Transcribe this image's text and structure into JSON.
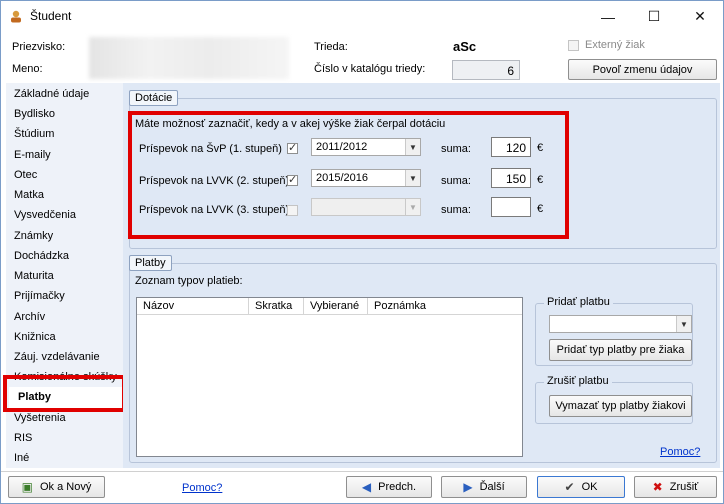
{
  "window": {
    "title": "Študent"
  },
  "header": {
    "surname_label": "Priezvisko:",
    "firstname_label": "Meno:",
    "class_label": "Trieda:",
    "class_value": "aSc",
    "catalog_label": "Číslo v katalógu triedy:",
    "catalog_value": "6",
    "external_label": "Externý žiak",
    "allow_change_button": "Povoľ zmenu údajov"
  },
  "sidebar": {
    "items": [
      "Základné údaje",
      "Bydlisko",
      "Štúdium",
      "E-maily",
      "Otec",
      "Matka",
      "Vysvedčenia",
      "Známky",
      "Dochádzka",
      "Maturita",
      "Prijímačky",
      "Archív",
      "Knižnica",
      "Záuj. vzdelávanie",
      "Komisionálne skúšky",
      "Platby",
      "Vyšetrenia",
      "RIS",
      "Iné"
    ],
    "selected": "Platby"
  },
  "dotacie": {
    "legend": "Dotácie",
    "intro": "Máte možnosť zaznačiť, kedy a v akej výške žiak čerpal dotáciu",
    "sum_label": "suma:",
    "currency": "€",
    "rows": [
      {
        "label": "Príspevok na ŠvP (1. stupeň)",
        "checked": true,
        "year": "2011/2012",
        "amount": "120",
        "enabled": true
      },
      {
        "label": "Príspevok na LVVK (2. stupeň)",
        "checked": true,
        "year": "2015/2016",
        "amount": "150",
        "enabled": true
      },
      {
        "label": "Príspevok na LVVK (3. stupeň)",
        "checked": false,
        "year": "",
        "amount": "",
        "enabled": false
      }
    ]
  },
  "platby": {
    "legend": "Platby",
    "list_label": "Zoznam typov platieb:",
    "columns": [
      "Názov",
      "Skratka",
      "Vybierané",
      "Poznámka"
    ],
    "add_group": "Pridať platbu",
    "add_button": "Pridať typ platby pre žiaka",
    "cancel_group": "Zrušiť platbu",
    "cancel_button": "Vymazať typ platby žiakovi",
    "help_link": "Pomoc?"
  },
  "footer": {
    "ok_new": "Ok a Nový",
    "help_link": "Pomoc?",
    "prev": "Predch.",
    "next": "Ďalší",
    "ok": "OK",
    "cancel": "Zrušiť"
  },
  "colors": {
    "highlight": "#e00000",
    "panel": "#dfe8f5",
    "nav": "#eef2f9",
    "link": "#0033cc"
  }
}
